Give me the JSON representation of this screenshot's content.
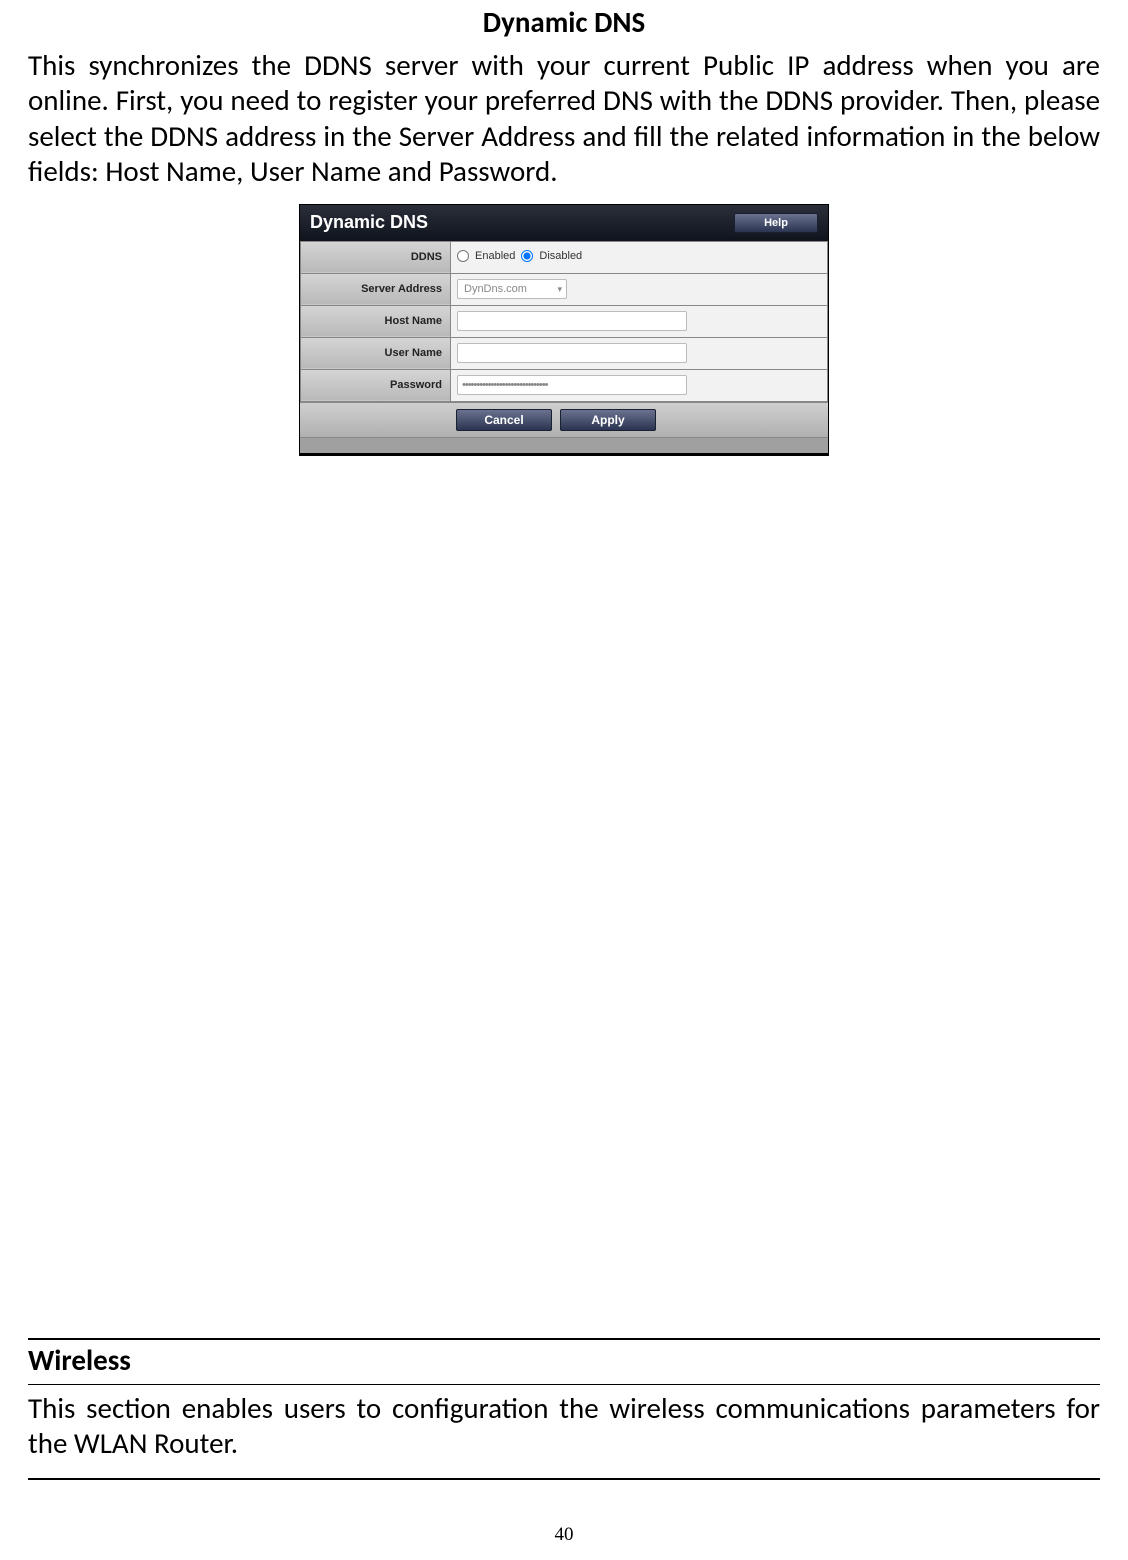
{
  "page": {
    "title1": "Dynamic DNS",
    "para1": "This synchronizes the DDNS server with your current Public IP address when you are online.  First, you need to register your preferred DNS with the DDNS provider.  Then, please select the DDNS address in the Server Address and fill the related information in the below fields: Host Name, User Name and Password.",
    "title2": "Wireless",
    "para2": "This section enables users to configuration the wireless communications parameters for the WLAN Router.",
    "number": "40"
  },
  "panel": {
    "header": "Dynamic DNS",
    "help": "Help",
    "labels": {
      "ddns": "DDNS",
      "server": "Server Address",
      "host": "Host Name",
      "user": "User Name",
      "pass": "Password"
    },
    "radio": {
      "enabled": "Enabled",
      "disabled": "Disabled"
    },
    "server_value": "DynDns.com",
    "password_dots": "••••••••••••••••••••••••••••••",
    "buttons": {
      "cancel": "Cancel",
      "apply": "Apply"
    }
  }
}
